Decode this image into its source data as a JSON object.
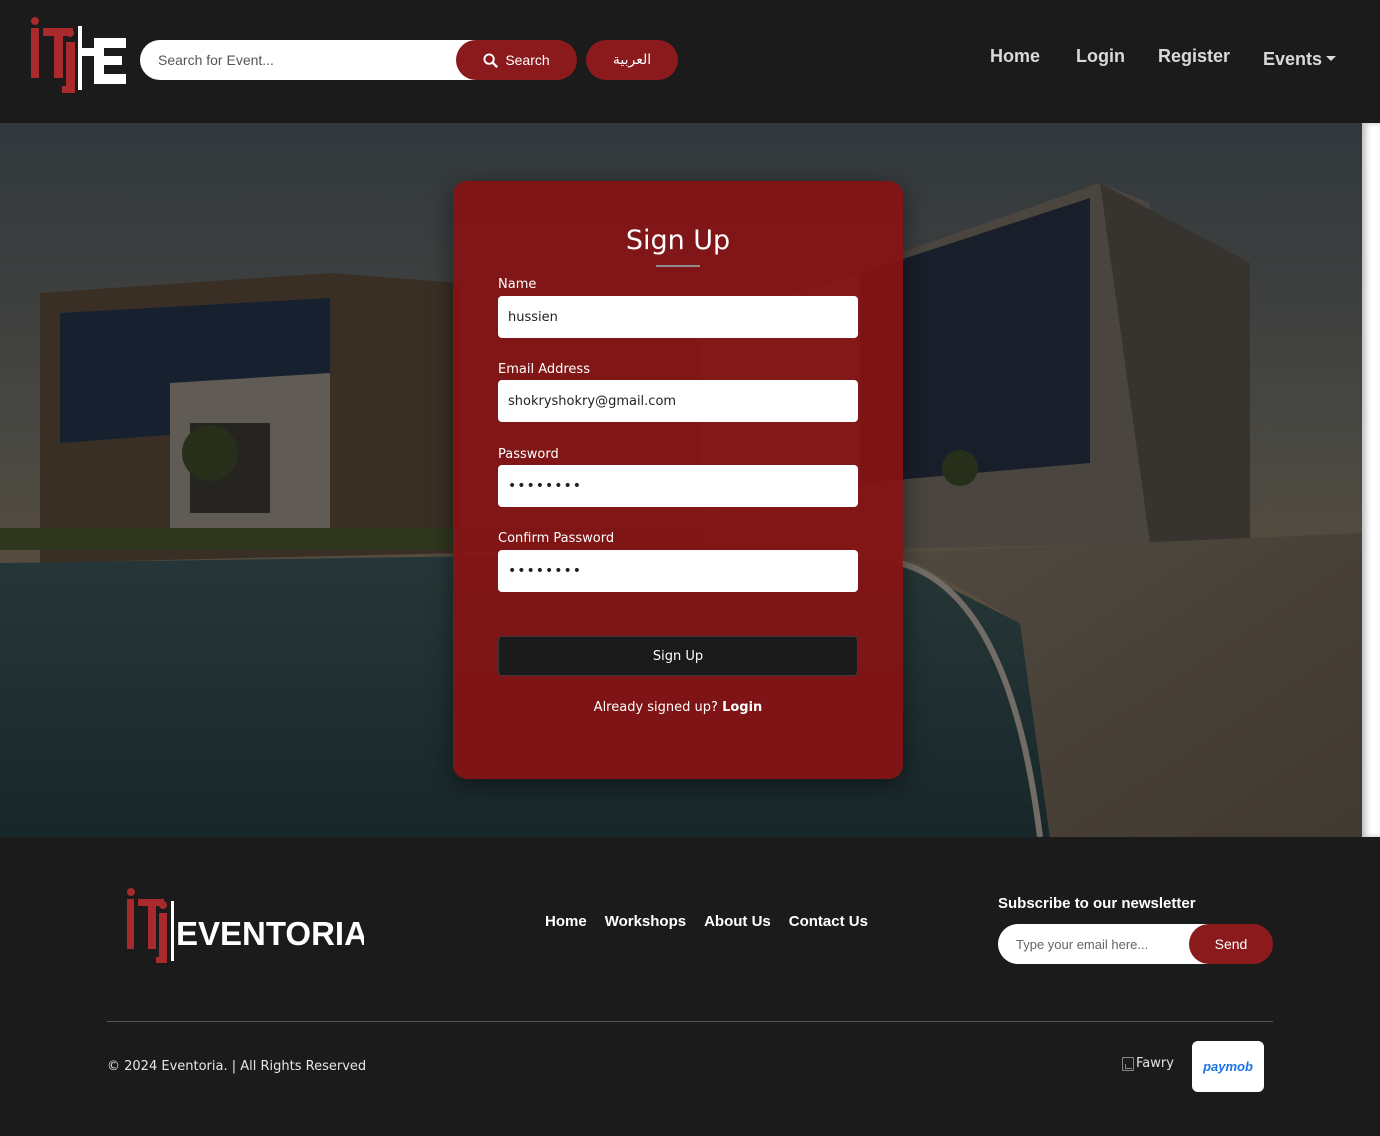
{
  "header": {
    "search_placeholder": "Search for Event...",
    "search_button": "Search",
    "language_button": "العربية",
    "nav": {
      "home": "Home",
      "login": "Login",
      "register": "Register",
      "events": "Events"
    }
  },
  "signup_form": {
    "title": "Sign Up",
    "fields": {
      "name_label": "Name",
      "name_value": "hussien",
      "email_label": "Email Address",
      "email_value": "shokryshokry@gmail.com",
      "password_label": "Password",
      "password_value": "••••••••",
      "confirm_label": "Confirm Password",
      "confirm_value": "••••••••"
    },
    "submit_button": "Sign Up",
    "already_text": "Already signed up?",
    "login_link": "Login"
  },
  "footer": {
    "brand": "EVENTORIA",
    "links": [
      "Home",
      "Workshops",
      "About Us",
      "Contact Us"
    ],
    "newsletter_title": "Subscribe to our newsletter",
    "newsletter_placeholder": "Type your email here...",
    "newsletter_button": "Send",
    "copyright": "© 2024 Eventoria. | All Rights Reserved",
    "payment_fawry_alt": "Fawry",
    "payment_paymob": "paymob"
  },
  "colors": {
    "brand_red": "#8b1a1c",
    "background_dark": "#1b1b1b",
    "card_red": "#871214"
  },
  "icons": {
    "search": "search-icon",
    "dropdown": "caret-down-icon",
    "broken_image": "broken-image-icon"
  }
}
